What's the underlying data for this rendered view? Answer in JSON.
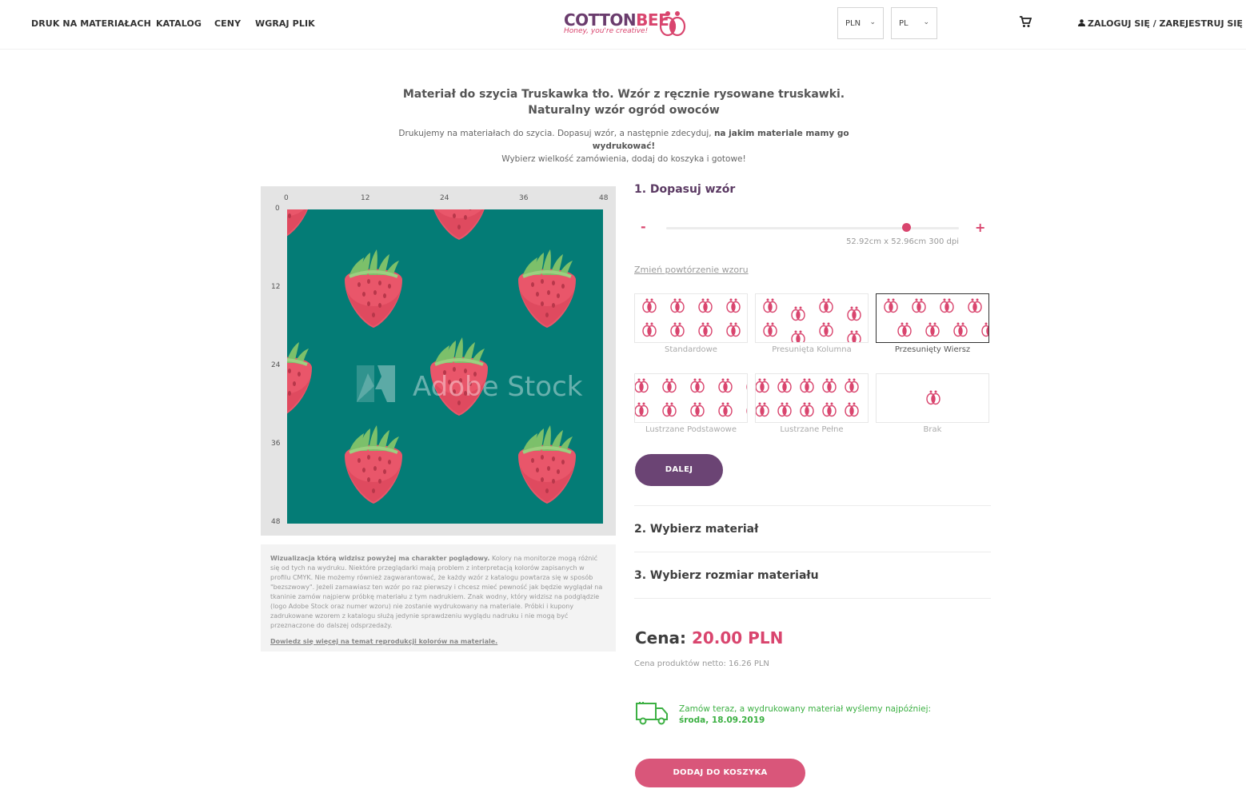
{
  "nav": {
    "items": [
      "DRUK NA MATERIAŁACH",
      "KATALOG",
      "CENY",
      "WGRAJ PLIK"
    ]
  },
  "logo": {
    "word_a": "COTTON",
    "word_b": "BEE",
    "tagline": "Honey, you're creative!"
  },
  "currency": {
    "value": "PLN"
  },
  "language": {
    "value": "PL"
  },
  "account": {
    "label": "ZALOGUJ SIĘ /  ZAREJESTRUJ SIĘ"
  },
  "product": {
    "title": "Materiał do szycia Truskawka tło. Wzór z ręcznie rysowane truskawki. Naturalny wzór ogród owoców",
    "subtitle_a": "Drukujemy na materiałach do szycia. Dopasuj wzór, a następnie zdecyduj, ",
    "subtitle_b": "na jakim materiale mamy go wydrukować!",
    "subtitle_c": "Wybierz wielkość zamówienia, dodaj do koszyka i gotowe!"
  },
  "preview": {
    "top_ticks": [
      "0",
      "12",
      "24",
      "36",
      "48"
    ],
    "left_ticks": [
      "0",
      "12",
      "24",
      "36",
      "48"
    ],
    "watermark": "Adobe Stock"
  },
  "note": {
    "bold": "Wizualizacja którą widzisz powyżej ma charakter poglądowy.",
    "text": " Kolory na monitorze mogą różnić się od tych na wydruku. Niektóre przeglądarki mają problem z interpretacją kolorów zapisanych w profilu CMYK. Nie możemy również zagwarantować, że każdy wzór z katalogu powtarza się w sposób \"bezszwowy\". Jeżeli zamawiasz ten wzór po raz pierwszy i chcesz mieć pewność jak będzie wyglądał na tkaninie zamów najpierw próbkę materiału z tym nadrukiem. Znak wodny, który widzisz na podglądzie (logo Adobe Stock oraz numer wzoru) nie zostanie wydrukowany na materiale. Próbki i kupony zadrukowane wzorem z katalogu służą jedynie sprawdzeniu wyglądu nadruku i nie mogą być przeznaczone do dalszej odsprzedaży.",
    "link": "Dowiedz się więcej na temat reprodukcji kolorów na materiale."
  },
  "step1": {
    "title": "1. Dopasuj wzór",
    "minus": "-",
    "plus": "+",
    "slider_value": 0.82,
    "dims": "52.92cm x 52.96cm 300 dpi",
    "change_link": "Zmień powtórzenie wzoru",
    "repeats": [
      {
        "label": "Standardowe"
      },
      {
        "label": "Presunięta Kolumna"
      },
      {
        "label": "Przesunięty Wiersz"
      },
      {
        "label": "Lustrzane Podstawowe"
      },
      {
        "label": "Lustrzane Pełne"
      },
      {
        "label": "Brak"
      }
    ],
    "selected_repeat": "Przesunięty Wiersz",
    "next": "DALEJ"
  },
  "step2": {
    "title": "2. Wybierz materiał"
  },
  "step3": {
    "title": "3. Wybierz rozmiar materiału"
  },
  "pricing": {
    "label": "Cena: ",
    "value": "20.00 PLN",
    "net": "Cena produktów netto: 16.26 PLN"
  },
  "shipping": {
    "line1": "Zamów teraz, a wydrukowany materiał wyślemy najpóźniej:",
    "date": "środa, 18.09.2019"
  },
  "cart_button": "DODAJ DO KOSZYKA",
  "colors": {
    "accent": "#d9456e",
    "purple": "#6b4474",
    "teal": "#047c76",
    "green": "#3cb043"
  }
}
